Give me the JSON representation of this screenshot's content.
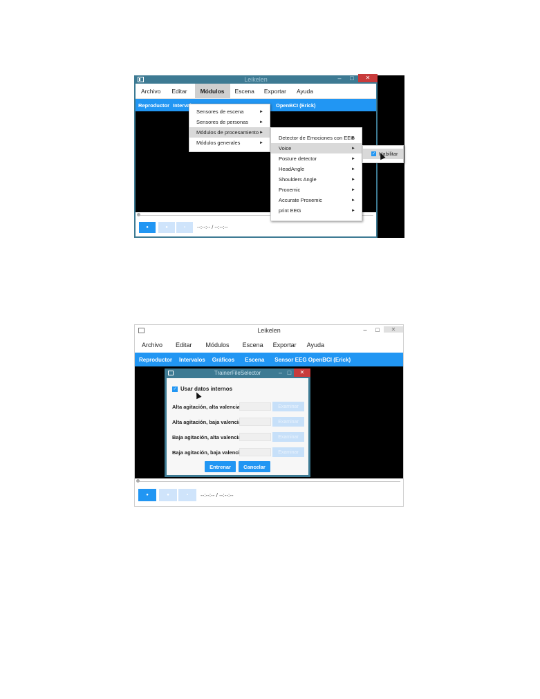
{
  "screenshot1": {
    "window_title": "Leikelen",
    "menubar": [
      "Archivo",
      "Editar",
      "Módulos",
      "Escena",
      "Exportar",
      "Ayuda"
    ],
    "tabs": [
      "Reproductor",
      "Intervalos",
      "OpenBCI (Erick)"
    ],
    "menu_modulos": [
      {
        "label": "Sensores de escena",
        "submenu": true
      },
      {
        "label": "Sensores de personas",
        "submenu": true
      },
      {
        "label": "Módulos de procesamiento",
        "submenu": true
      },
      {
        "label": "Módulos generales",
        "submenu": true
      }
    ],
    "menu_procesamiento": [
      {
        "label": "Detector de Emociones con EEG",
        "submenu": true
      },
      {
        "label": "Voice",
        "submenu": true
      },
      {
        "label": "Posture detector",
        "submenu": true
      },
      {
        "label": "HeadAngle",
        "submenu": true
      },
      {
        "label": "Shoulders Angle",
        "submenu": true
      },
      {
        "label": "Proxemic",
        "submenu": true
      },
      {
        "label": "Accurate Proxemic",
        "submenu": true
      },
      {
        "label": "print EEG",
        "submenu": true
      }
    ],
    "menu_voice": [
      {
        "label": "Habilitar",
        "checked": true
      }
    ],
    "time": "--:--:-- / --:--:--"
  },
  "screenshot2": {
    "window_title": "Leikelen",
    "menubar": [
      "Archivo",
      "Editar",
      "Módulos",
      "Escena",
      "Exportar",
      "Ayuda"
    ],
    "tabs": [
      "Reproductor",
      "Intervalos",
      "Gráficos",
      "Escena",
      "Sensor EEG OpenBCI (Erick)"
    ],
    "dialog": {
      "title": "TrainerFileSelector",
      "checkbox_label": "Usar datos internos",
      "checkbox_checked": true,
      "rows": [
        {
          "label": "Alta agitación, alta valencia",
          "button": "Examinar"
        },
        {
          "label": "Alta agitación, baja valencia",
          "button": "Examinar"
        },
        {
          "label": "Baja agitación, alta valencia",
          "button": "Examinar"
        },
        {
          "label": "Baja agitación, baja valencia",
          "button": "Examinar"
        }
      ],
      "train_button": "Entrenar",
      "cancel_button": "Cancelar"
    },
    "time": "--:--:-- / --:--:--"
  },
  "colors": {
    "accent": "#2196f3",
    "title_bar_1": "#3d7a93",
    "title_bar_2": "#ffffff",
    "close_red": "#c83b3b"
  }
}
